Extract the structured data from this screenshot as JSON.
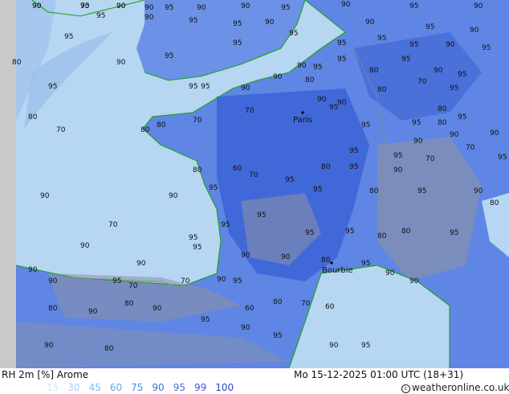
{
  "header": {
    "title": "RH 2m [%] Arome",
    "timestamp": "Mo 15-12-2025 01:00 UTC (18+31)",
    "credit": "weatheronline.co.uk"
  },
  "legend": {
    "values": [
      "15",
      "30",
      "45",
      "60",
      "75",
      "90",
      "95",
      "99",
      "100"
    ],
    "colors": [
      "#cfe6f7",
      "#a8d0f0",
      "#88bde8",
      "#5fa9e6",
      "#4c8fe0",
      "#3f74d8",
      "#4f6ee0",
      "#3a5bd0",
      "#2a46c0"
    ]
  },
  "map": {
    "cities": [
      {
        "name": "Paris"
      },
      {
        "name": "Bourbie"
      }
    ],
    "contour_labels": [
      "90",
      "95",
      "90",
      "90",
      "95",
      "90",
      "90",
      "95",
      "90",
      "95",
      "90",
      "95",
      "90",
      "95",
      "95",
      "90",
      "90",
      "95",
      "90",
      "95",
      "95",
      "95",
      "95",
      "95",
      "95",
      "95",
      "90",
      "95",
      "80",
      "90",
      "90",
      "95",
      "95",
      "80",
      "95",
      "90",
      "95",
      "90",
      "80",
      "95",
      "95",
      "95",
      "90",
      "90",
      "90",
      "80",
      "70",
      "95",
      "80",
      "70",
      "80",
      "80",
      "70",
      "70",
      "95",
      "95",
      "80",
      "95",
      "95",
      "80",
      "95",
      "90",
      "90",
      "90",
      "95",
      "70",
      "70",
      "80",
      "60",
      "70",
      "80",
      "95",
      "90",
      "95",
      "90",
      "90",
      "95",
      "95",
      "95",
      "80",
      "95",
      "90",
      "80",
      "70",
      "95",
      "95",
      "95",
      "95",
      "95",
      "80",
      "80",
      "95",
      "90",
      "90",
      "95",
      "90",
      "90",
      "80",
      "95",
      "90",
      "90",
      "90",
      "90",
      "95",
      "70",
      "70",
      "90",
      "95",
      "60",
      "80",
      "70",
      "60",
      "80",
      "90",
      "80",
      "90",
      "95",
      "90",
      "95",
      "90",
      "95",
      "90",
      "80",
      "90",
      "70",
      "90"
    ],
    "colors": {
      "sea": "#b6d6f2",
      "sea_dark": "#98c0ea",
      "land": "#5f86e4",
      "land_dark": "#3f65d8",
      "mountain": "#8a8f9e",
      "coast": "#1aa01a",
      "border": "#999"
    }
  }
}
